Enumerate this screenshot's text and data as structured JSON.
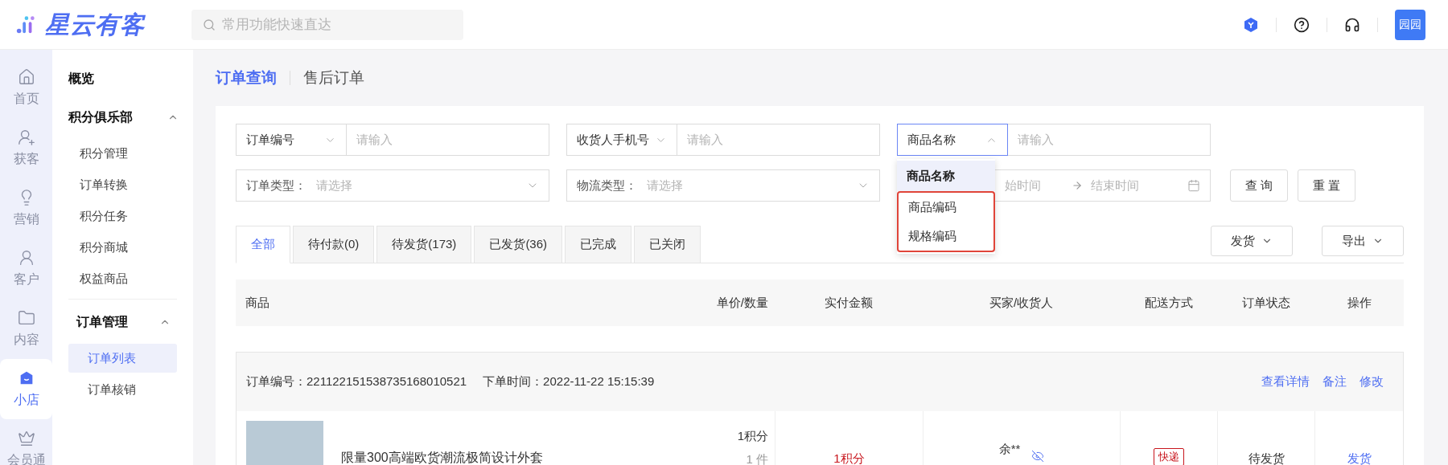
{
  "brand": {
    "name": "星云有客"
  },
  "search": {
    "placeholder": "常用功能快速直达"
  },
  "user": {
    "avatar_text": "园园"
  },
  "rail": [
    {
      "label": "首页",
      "selected": false
    },
    {
      "label": "获客",
      "selected": false
    },
    {
      "label": "营销",
      "selected": false
    },
    {
      "label": "客户",
      "selected": false
    },
    {
      "label": "内容",
      "selected": false
    },
    {
      "label": "小店",
      "selected": true
    },
    {
      "label": "会员通",
      "selected": false
    }
  ],
  "submenu": [
    {
      "label": "概览",
      "kind": "link"
    },
    {
      "label": "积分俱乐部",
      "kind": "group",
      "expanded": true,
      "children": [
        {
          "label": "积分管理",
          "selected": false
        },
        {
          "label": "订单转换",
          "selected": false
        },
        {
          "label": "积分任务",
          "selected": false
        },
        {
          "label": "积分商城",
          "selected": false
        },
        {
          "label": "权益商品",
          "selected": false
        }
      ]
    },
    {
      "label": "订单管理",
      "kind": "group",
      "expanded": true,
      "children": [
        {
          "label": "订单列表",
          "selected": true
        },
        {
          "label": "订单核销",
          "selected": false
        }
      ]
    }
  ],
  "page_tabs": [
    {
      "label": "订单查询",
      "selected": true
    },
    {
      "label": "售后订单",
      "selected": false
    }
  ],
  "filters_row1": [
    {
      "label": "订单编号",
      "placeholder": "请输入",
      "open": false
    },
    {
      "label": "收货人手机号",
      "placeholder": "请输入",
      "open": false
    },
    {
      "label": "商品名称",
      "placeholder": "请输入",
      "open": true
    }
  ],
  "filters_row2": [
    {
      "kind": "select",
      "label": "订单类型：",
      "placeholder": "请选择"
    },
    {
      "kind": "select",
      "label": "物流类型：",
      "placeholder": "请选择"
    },
    {
      "kind": "date_range",
      "start_placeholder": "始时间",
      "end_placeholder": "结束时间"
    }
  ],
  "buttons": [
    "查 询",
    "重 置"
  ],
  "dropdown": {
    "options": [
      {
        "label": "商品名称",
        "selected": true,
        "highlighted": false
      },
      {
        "label": "商品编码",
        "selected": false,
        "highlighted": true
      },
      {
        "label": "规格编码",
        "selected": false,
        "highlighted": true
      }
    ]
  },
  "status_tabs": [
    {
      "label": "全部",
      "selected": true
    },
    {
      "label": "待付款(0)",
      "selected": false
    },
    {
      "label": "待发货(173)",
      "selected": false
    },
    {
      "label": "已发货(36)",
      "selected": false
    },
    {
      "label": "已完成",
      "selected": false
    },
    {
      "label": "已关闭",
      "selected": false
    }
  ],
  "actions": [
    "发货",
    "导出"
  ],
  "table": {
    "columns": [
      "商品",
      "单价/数量",
      "实付金额",
      "买家/收货人",
      "配送方式",
      "订单状态",
      "操作"
    ],
    "orders": [
      {
        "order_no_label": "订单编号：",
        "order_no": "221122151538735168010521",
        "time_label": "下单时间：",
        "time": "2022-11-22 15:15:39",
        "links": [
          "查看详情",
          "备注",
          "修改"
        ],
        "items": [
          {
            "title": "限量300高端欧货潮流极简设计外套",
            "price": "1积分",
            "qty": "1 件",
            "amount": "1积分",
            "buyer": "余**",
            "delivery": "快递",
            "status": "待发货",
            "action": "发货"
          }
        ]
      }
    ]
  }
}
